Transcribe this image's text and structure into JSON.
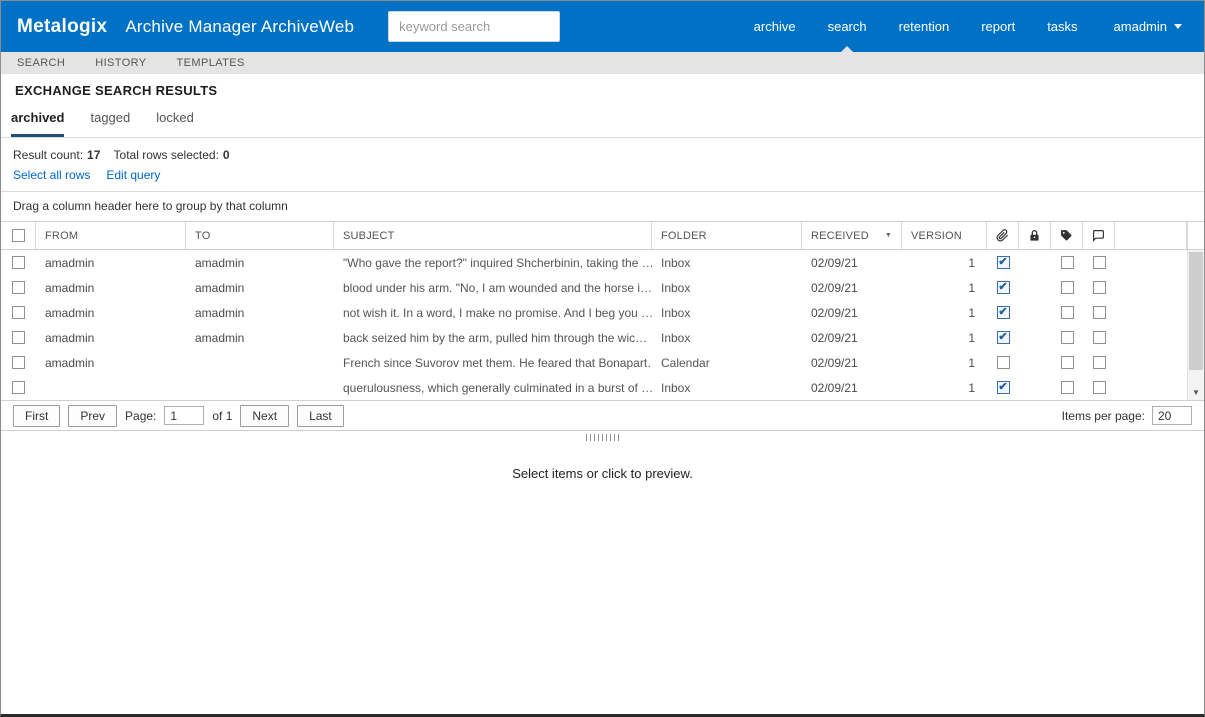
{
  "header": {
    "logo": "Metalogix",
    "app_title": "Archive Manager ArchiveWeb",
    "search_placeholder": "keyword search",
    "nav": [
      {
        "label": "archive",
        "active": false
      },
      {
        "label": "search",
        "active": true
      },
      {
        "label": "retention",
        "active": false
      },
      {
        "label": "report",
        "active": false
      },
      {
        "label": "tasks",
        "active": false
      }
    ],
    "user": {
      "label": "amadmin"
    }
  },
  "subnav": {
    "items": [
      {
        "label": "SEARCH"
      },
      {
        "label": "HISTORY"
      },
      {
        "label": "TEMPLATES"
      }
    ]
  },
  "page_title": "EXCHANGE SEARCH RESULTS",
  "result_tabs": [
    {
      "label": "archived",
      "active": true
    },
    {
      "label": "tagged",
      "active": false
    },
    {
      "label": "locked",
      "active": false
    }
  ],
  "summary": {
    "result_count_label": "Result count:",
    "result_count_value": "17",
    "rows_selected_label": "Total rows selected:",
    "rows_selected_value": "0"
  },
  "links": {
    "select_all_rows": "Select all rows",
    "edit_query": "Edit query"
  },
  "group_bar_text": "Drag a column header here to group by that column",
  "table": {
    "columns": {
      "from": "FROM",
      "to": "TO",
      "subject": "SUBJECT",
      "folder": "FOLDER",
      "received": "RECEIVED",
      "version": "VERSION"
    },
    "icon_columns": [
      "attachment",
      "locked",
      "tagged",
      "comment"
    ],
    "rows": [
      {
        "from": "amadmin",
        "to": "amadmin",
        "subject": "\"Who gave the report?\" inquired Shcherbinin, taking the …",
        "folder": "Inbox",
        "received": "02/09/21",
        "version": "1",
        "attachment": true,
        "tagged": false,
        "comment": false
      },
      {
        "from": "amadmin",
        "to": "amadmin",
        "subject": "blood under his arm. \"No, I am wounded and the horse i…",
        "folder": "Inbox",
        "received": "02/09/21",
        "version": "1",
        "attachment": true,
        "tagged": false,
        "comment": false
      },
      {
        "from": "amadmin",
        "to": "amadmin",
        "subject": "not wish it. In a word, I make no promise. And I beg you …",
        "folder": "Inbox",
        "received": "02/09/21",
        "version": "1",
        "attachment": true,
        "tagged": false,
        "comment": false
      },
      {
        "from": "amadmin",
        "to": "amadmin",
        "subject": "back seized him by the arm, pulled him through the wic…",
        "folder": "Inbox",
        "received": "02/09/21",
        "version": "1",
        "attachment": true,
        "tagged": false,
        "comment": false
      },
      {
        "from": "amadmin",
        "to": "",
        "subject": "French since Suvorov met them. He feared that Bonapart…",
        "folder": "Calendar",
        "received": "02/09/21",
        "version": "1",
        "attachment": false,
        "tagged": false,
        "comment": false
      },
      {
        "from": "",
        "to": "",
        "subject": "querulousness, which generally culminated in a burst of …",
        "folder": "Inbox",
        "received": "02/09/21",
        "version": "1",
        "attachment": true,
        "tagged": false,
        "comment": false
      }
    ]
  },
  "pagination": {
    "first": "First",
    "prev": "Prev",
    "page_label": "Page:",
    "page_value": "1",
    "of_label": "of 1",
    "next": "Next",
    "last": "Last",
    "items_per_page_label": "Items per page:",
    "items_per_page_value": "20"
  },
  "preview": {
    "placeholder": "Select items or click to preview."
  },
  "colors": {
    "topbar_blue": "#0072c6",
    "link_blue": "#0066cc",
    "active_tab_underline": "#1f4e79",
    "checked_checkbox": "#1f5ea8"
  }
}
